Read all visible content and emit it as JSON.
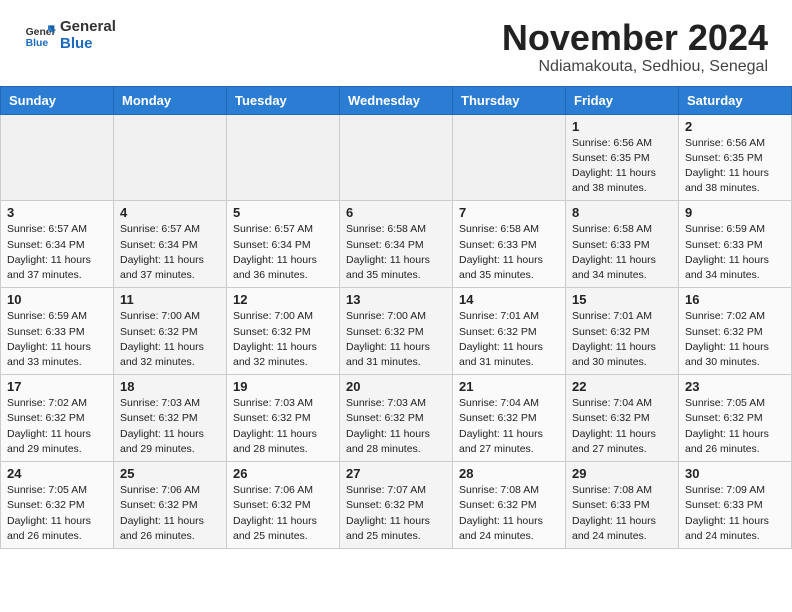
{
  "header": {
    "logo_general": "General",
    "logo_blue": "Blue",
    "month_year": "November 2024",
    "location": "Ndiamakouta, Sedhiou, Senegal"
  },
  "days_of_week": [
    "Sunday",
    "Monday",
    "Tuesday",
    "Wednesday",
    "Thursday",
    "Friday",
    "Saturday"
  ],
  "weeks": [
    [
      {
        "num": "",
        "info": ""
      },
      {
        "num": "",
        "info": ""
      },
      {
        "num": "",
        "info": ""
      },
      {
        "num": "",
        "info": ""
      },
      {
        "num": "",
        "info": ""
      },
      {
        "num": "1",
        "info": "Sunrise: 6:56 AM\nSunset: 6:35 PM\nDaylight: 11 hours and 38 minutes."
      },
      {
        "num": "2",
        "info": "Sunrise: 6:56 AM\nSunset: 6:35 PM\nDaylight: 11 hours and 38 minutes."
      }
    ],
    [
      {
        "num": "3",
        "info": "Sunrise: 6:57 AM\nSunset: 6:34 PM\nDaylight: 11 hours and 37 minutes."
      },
      {
        "num": "4",
        "info": "Sunrise: 6:57 AM\nSunset: 6:34 PM\nDaylight: 11 hours and 37 minutes."
      },
      {
        "num": "5",
        "info": "Sunrise: 6:57 AM\nSunset: 6:34 PM\nDaylight: 11 hours and 36 minutes."
      },
      {
        "num": "6",
        "info": "Sunrise: 6:58 AM\nSunset: 6:34 PM\nDaylight: 11 hours and 35 minutes."
      },
      {
        "num": "7",
        "info": "Sunrise: 6:58 AM\nSunset: 6:33 PM\nDaylight: 11 hours and 35 minutes."
      },
      {
        "num": "8",
        "info": "Sunrise: 6:58 AM\nSunset: 6:33 PM\nDaylight: 11 hours and 34 minutes."
      },
      {
        "num": "9",
        "info": "Sunrise: 6:59 AM\nSunset: 6:33 PM\nDaylight: 11 hours and 34 minutes."
      }
    ],
    [
      {
        "num": "10",
        "info": "Sunrise: 6:59 AM\nSunset: 6:33 PM\nDaylight: 11 hours and 33 minutes."
      },
      {
        "num": "11",
        "info": "Sunrise: 7:00 AM\nSunset: 6:32 PM\nDaylight: 11 hours and 32 minutes."
      },
      {
        "num": "12",
        "info": "Sunrise: 7:00 AM\nSunset: 6:32 PM\nDaylight: 11 hours and 32 minutes."
      },
      {
        "num": "13",
        "info": "Sunrise: 7:00 AM\nSunset: 6:32 PM\nDaylight: 11 hours and 31 minutes."
      },
      {
        "num": "14",
        "info": "Sunrise: 7:01 AM\nSunset: 6:32 PM\nDaylight: 11 hours and 31 minutes."
      },
      {
        "num": "15",
        "info": "Sunrise: 7:01 AM\nSunset: 6:32 PM\nDaylight: 11 hours and 30 minutes."
      },
      {
        "num": "16",
        "info": "Sunrise: 7:02 AM\nSunset: 6:32 PM\nDaylight: 11 hours and 30 minutes."
      }
    ],
    [
      {
        "num": "17",
        "info": "Sunrise: 7:02 AM\nSunset: 6:32 PM\nDaylight: 11 hours and 29 minutes."
      },
      {
        "num": "18",
        "info": "Sunrise: 7:03 AM\nSunset: 6:32 PM\nDaylight: 11 hours and 29 minutes."
      },
      {
        "num": "19",
        "info": "Sunrise: 7:03 AM\nSunset: 6:32 PM\nDaylight: 11 hours and 28 minutes."
      },
      {
        "num": "20",
        "info": "Sunrise: 7:03 AM\nSunset: 6:32 PM\nDaylight: 11 hours and 28 minutes."
      },
      {
        "num": "21",
        "info": "Sunrise: 7:04 AM\nSunset: 6:32 PM\nDaylight: 11 hours and 27 minutes."
      },
      {
        "num": "22",
        "info": "Sunrise: 7:04 AM\nSunset: 6:32 PM\nDaylight: 11 hours and 27 minutes."
      },
      {
        "num": "23",
        "info": "Sunrise: 7:05 AM\nSunset: 6:32 PM\nDaylight: 11 hours and 26 minutes."
      }
    ],
    [
      {
        "num": "24",
        "info": "Sunrise: 7:05 AM\nSunset: 6:32 PM\nDaylight: 11 hours and 26 minutes."
      },
      {
        "num": "25",
        "info": "Sunrise: 7:06 AM\nSunset: 6:32 PM\nDaylight: 11 hours and 26 minutes."
      },
      {
        "num": "26",
        "info": "Sunrise: 7:06 AM\nSunset: 6:32 PM\nDaylight: 11 hours and 25 minutes."
      },
      {
        "num": "27",
        "info": "Sunrise: 7:07 AM\nSunset: 6:32 PM\nDaylight: 11 hours and 25 minutes."
      },
      {
        "num": "28",
        "info": "Sunrise: 7:08 AM\nSunset: 6:32 PM\nDaylight: 11 hours and 24 minutes."
      },
      {
        "num": "29",
        "info": "Sunrise: 7:08 AM\nSunset: 6:33 PM\nDaylight: 11 hours and 24 minutes."
      },
      {
        "num": "30",
        "info": "Sunrise: 7:09 AM\nSunset: 6:33 PM\nDaylight: 11 hours and 24 minutes."
      }
    ]
  ]
}
